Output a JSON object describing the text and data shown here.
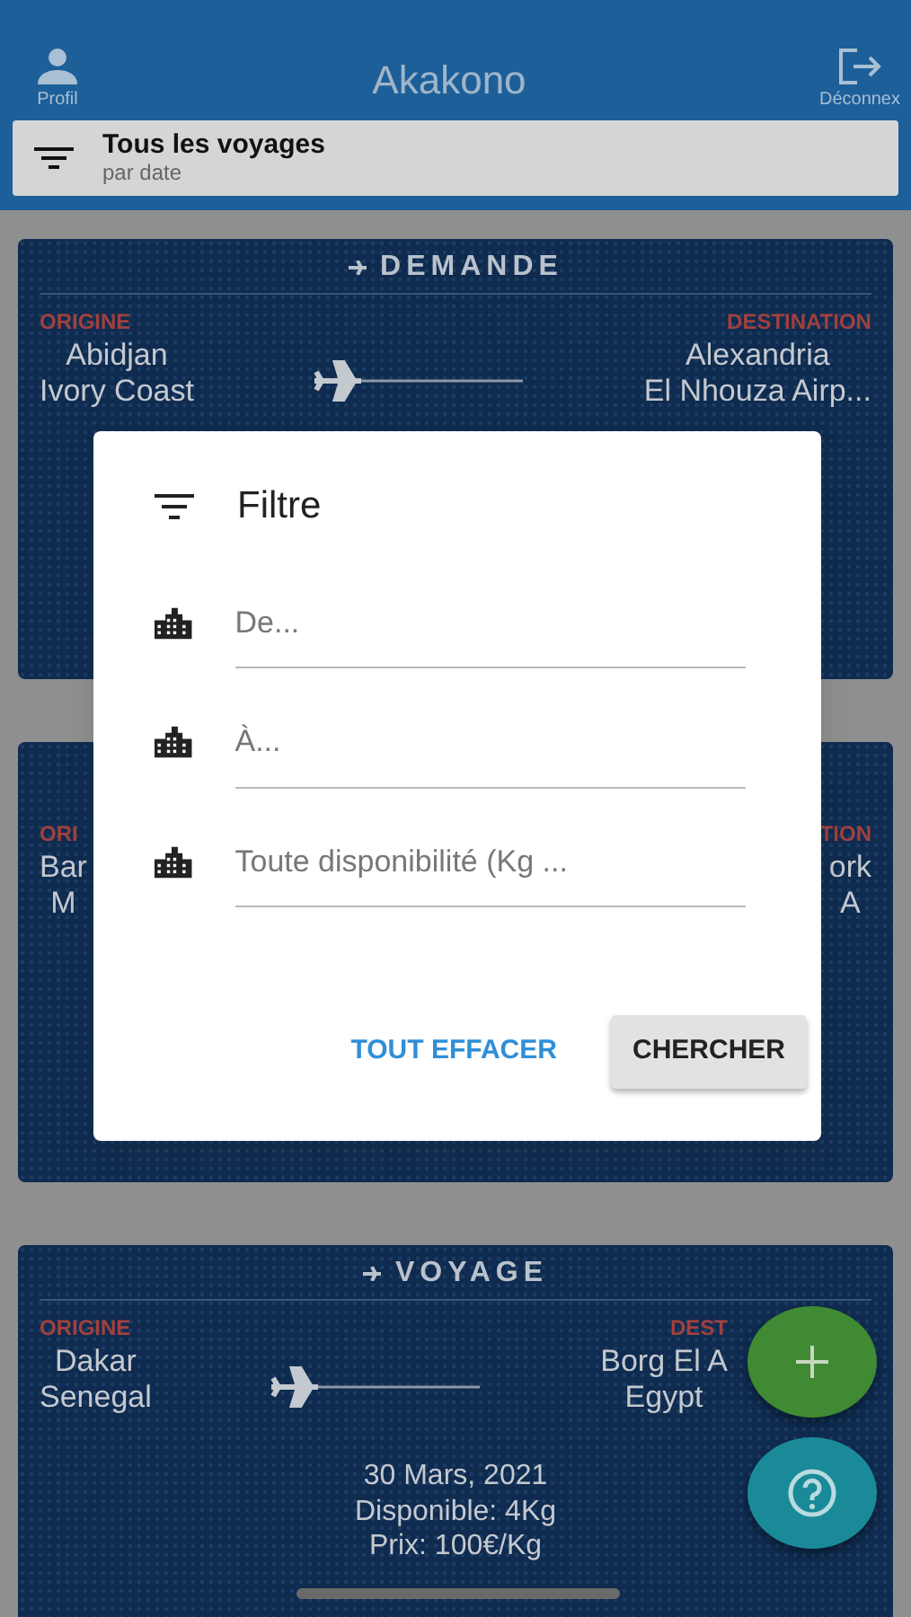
{
  "header": {
    "left_action": {
      "label": "Profil"
    },
    "title": "Akakono",
    "right_action": {
      "label": "Déconnex"
    }
  },
  "sort_bar": {
    "title": "Tous les voyages",
    "subtitle": "par date"
  },
  "cards": [
    {
      "header": "DEMANDE",
      "origin_label": "ORIGINE",
      "origin_lines": [
        "Abidjan",
        "Ivory Coast"
      ],
      "dest_label": "DESTINATION",
      "dest_lines": [
        "Alexandria",
        "El Nhouza Airp..."
      ]
    },
    {
      "origin_label": "ORI",
      "origin_lines": [
        "Bar",
        "M"
      ],
      "dest_label": "TION",
      "dest_lines": [
        "ork",
        "A"
      ]
    },
    {
      "header": "VOYAGE",
      "origin_label": "ORIGINE",
      "origin_lines": [
        "Dakar",
        "Senegal"
      ],
      "dest_label": "DEST",
      "dest_lines": [
        "Borg El A",
        "Egypt"
      ],
      "details": [
        "30 Mars, 2021",
        "Disponible: 4Kg",
        "Prix: 100€/Kg"
      ]
    }
  ],
  "dialog": {
    "title": "Filtre",
    "fields": [
      {
        "placeholder": "De..."
      },
      {
        "placeholder": "À..."
      },
      {
        "placeholder": "Toute disponibilité (Kg ..."
      }
    ],
    "buttons": [
      {
        "label": "TOUT EFFACER",
        "kind": "text"
      },
      {
        "label": "CHERCHER",
        "kind": "raised"
      }
    ]
  },
  "fabs": [
    {
      "kind": "add"
    },
    {
      "kind": "help"
    }
  ]
}
